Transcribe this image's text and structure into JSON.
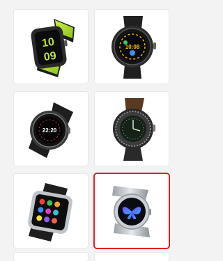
{
  "grid": {
    "items": [
      {
        "name": "Square smartwatch, black with lime green strap",
        "face": {
          "hour": "10",
          "minute": "09"
        },
        "selected": false
      },
      {
        "name": "Round smartwatch, black sport",
        "face": {
          "time": "10:08"
        },
        "selected": false
      },
      {
        "name": "Round smartwatch, black with leather strap",
        "face": {
          "time": "22:20"
        },
        "selected": false
      },
      {
        "name": "Round smartwatch, bezel with brown leather strap",
        "selected": false
      },
      {
        "name": "Square smartwatch, silver with black strap",
        "selected": false
      },
      {
        "name": "Round smartwatch, silver mesh with butterfly face",
        "selected": true
      }
    ]
  },
  "colors": {
    "selection": "#e02020",
    "lime": "#a6d92a",
    "background": "#f3f3f3"
  }
}
